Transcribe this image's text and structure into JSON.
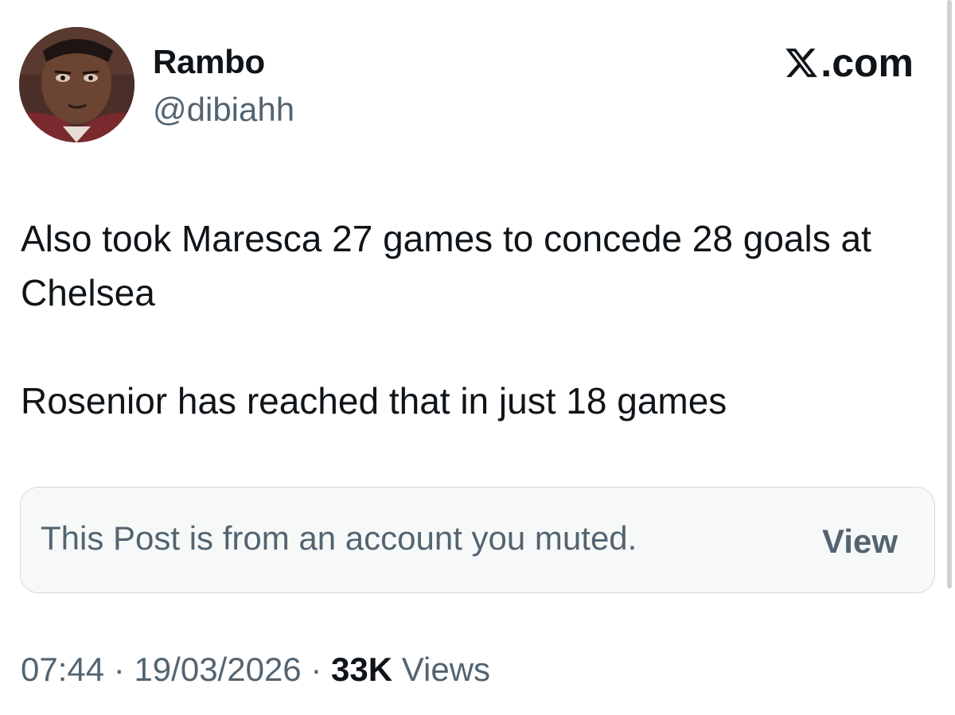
{
  "user": {
    "display_name": "Rambo",
    "handle": "@dibiahh"
  },
  "brand": {
    "label": ".com",
    "icon": "x-logo-icon"
  },
  "post": {
    "paragraph_1": "Also took Maresca 27 games to concede 28 goals at Chelsea",
    "paragraph_2": "Rosenior has reached that in just 18 games"
  },
  "muted_notice": {
    "text": "This Post is from an account you muted.",
    "view_label": "View"
  },
  "meta": {
    "time": "07:44",
    "separator": "·",
    "date": "19/03/2026",
    "views_count": "33K",
    "views_label": "Views"
  },
  "colors": {
    "text_primary": "#0f1419",
    "text_secondary": "#536471",
    "muted_box_bg": "#f7f9f9",
    "muted_box_border": "#cfd9de"
  }
}
